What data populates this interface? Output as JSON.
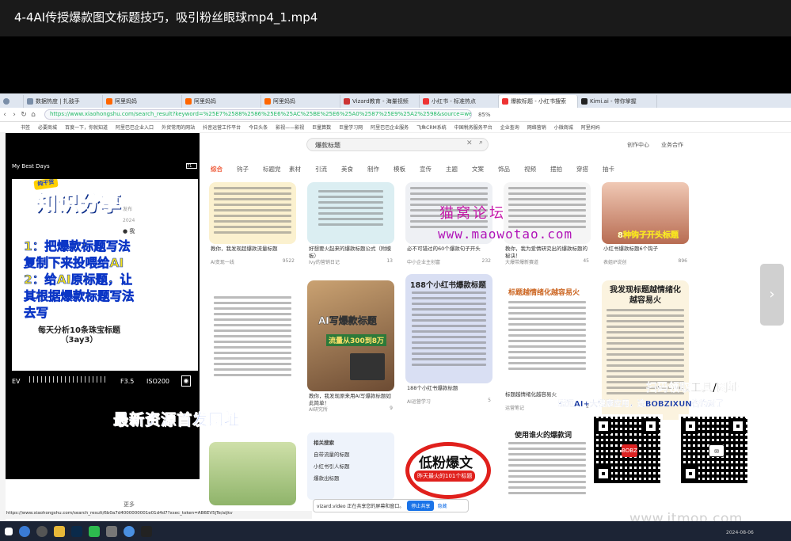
{
  "video_title": "4-4AI传授爆款图文标题技巧，吸引粉丝眼球mp4_1.mp4",
  "browser": {
    "tabs": [
      {
        "label": "数据热度 | 扎鼓手"
      },
      {
        "label": "阿里妈妈"
      },
      {
        "label": "阿里妈妈"
      },
      {
        "label": "阿里妈妈"
      },
      {
        "label": "Vizard教育 - 海量视频"
      },
      {
        "label": "小红书 - 标准热点"
      },
      {
        "label": "爆款标题 - 小红书搜索"
      },
      {
        "label": "Kimi.ai - 带你掌握"
      }
    ],
    "active_tab_index": 6,
    "url": "https://www.xiaohongshu.com/search_result?keyword=%25E7%2588%2586%25E6%25AC%25BE%25E6%25A0%2587%25E9%25A2%2598&source=web_exp",
    "zoom": "85%",
    "bookmarks": [
      "书签",
      "必要商城",
      "百度一下，你就知道",
      "阿里巴巴企业入口",
      "外贸常用的网站",
      "抖音运营工作平台",
      "今日头条",
      "影视——影视",
      "巨量算数",
      "巨量学习网",
      "阿里巴巴企业服务",
      "飞鱼CRM系统",
      "中国税务服务平台",
      "企业查询",
      "网络营销",
      "小微商城",
      "阿里妈妈"
    ]
  },
  "page": {
    "search_value": "爆款标题",
    "top_links": [
      "创作中心",
      "业务合作"
    ],
    "categories": [
      "综合",
      "钩子",
      "标题党",
      "素材",
      "引流",
      "美食",
      "制作",
      "模板",
      "宣传",
      "主题",
      "文案",
      "饰品",
      "视频",
      "摆拍",
      "穿搭",
      "抽卡"
    ],
    "active_category": 0,
    "cards": [
      {
        "caption": "教你，我发现超爆款流量标题",
        "author": "AI变现一线",
        "likes": "9522"
      },
      {
        "caption": "好想要火起来的爆款标题公式（附模板）",
        "author": "Ivy的营销日记",
        "likes": "13"
      },
      {
        "caption": "必不可错过的60个爆款句子开头",
        "author": "中小企业主创富",
        "likes": "232"
      },
      {
        "caption": "教你，我为爱情研究出的爆款标题的秘诀！",
        "author": "大爆带爆新赛道",
        "likes": "45"
      },
      {
        "caption": "小红书爆款标题6个钩子",
        "author": "表姐IP说创",
        "likes": "896"
      },
      {
        "caption": "教你，我发现原来用AI写爆款标题如此简单！",
        "author": "AI研究所",
        "likes": "9"
      },
      {
        "caption": "188个小红书爆款标题",
        "author": "AI运营学习",
        "likes": "5"
      },
      {
        "caption": "标题越情绪化越容易火",
        "author": "运营笔记",
        "likes": "2"
      },
      {
        "caption": "我发现标题越情绪化越容易火",
        "author": "",
        "likes": ""
      },
      {
        "caption": "使用谁火的爆款词",
        "author": "",
        "likes": ""
      }
    ],
    "related": {
      "heading": "相关搜索",
      "items": [
        "自带流量的标题",
        "小红书引人标题",
        "爆款出标题"
      ]
    },
    "bottom_card_title": "低粉爆文",
    "bottom_card_sub": "昨天最火的101个标题",
    "ai_card_title": "AI写爆款标题",
    "ai_card_sub": "流量从300到8万",
    "list_card_title": "188个小红书爆款标题",
    "emotion_card_title": "标题越情绪化越容易火",
    "emotion_card2_title": "我发现标题越情绪化越容易火",
    "hook_card_title": "8种钩子开头标题",
    "more_label": "更多"
  },
  "phone": {
    "status": "My Best Days",
    "battery": "71",
    "badge": "纯干货",
    "title": "知识分享",
    "caption_right": [
      "发布",
      "2024"
    ],
    "me": "我",
    "note_lines": [
      "1：把爆款标题写法",
      "复制下来投喂给AI",
      "2：给AI原标题，让",
      "其根据爆款标题写法",
      "去写"
    ],
    "doc_title": "每天分析10条珠宝标题（3ay3）",
    "camera": {
      "ev": "EV",
      "aperture": "F3.5",
      "iso": "ISO200"
    }
  },
  "overlays": {
    "blue_banner": "最新资源首发网址",
    "watermark_cn": "猫窝论坛",
    "watermark_en": "www.maowotao.com",
    "qr_title": "扫码领取工具/网址",
    "qr_sub": "精通AI+大健康应用，选BOBZIXUN咨询对了",
    "qr_center_label": "BOBZ",
    "site_watermark": "www.itmop.com"
  },
  "share_bar": {
    "text": "vizard.video 正在共享您的屏幕和窗口。",
    "stop": "停止共享",
    "hide": "隐藏"
  },
  "status_url": "https://www.xiaohongshu.com/search_result/6b0a7d4000000001e01d4d7?xsec_token=AB6EV5jTe/aijkv",
  "taskbar_date": "2024-08-06",
  "colors": {
    "accent": "#e53935",
    "phone_blue": "#1e5fd8",
    "note_yellow": "#f7e21a",
    "watermark_magenta": "#b013b8"
  }
}
